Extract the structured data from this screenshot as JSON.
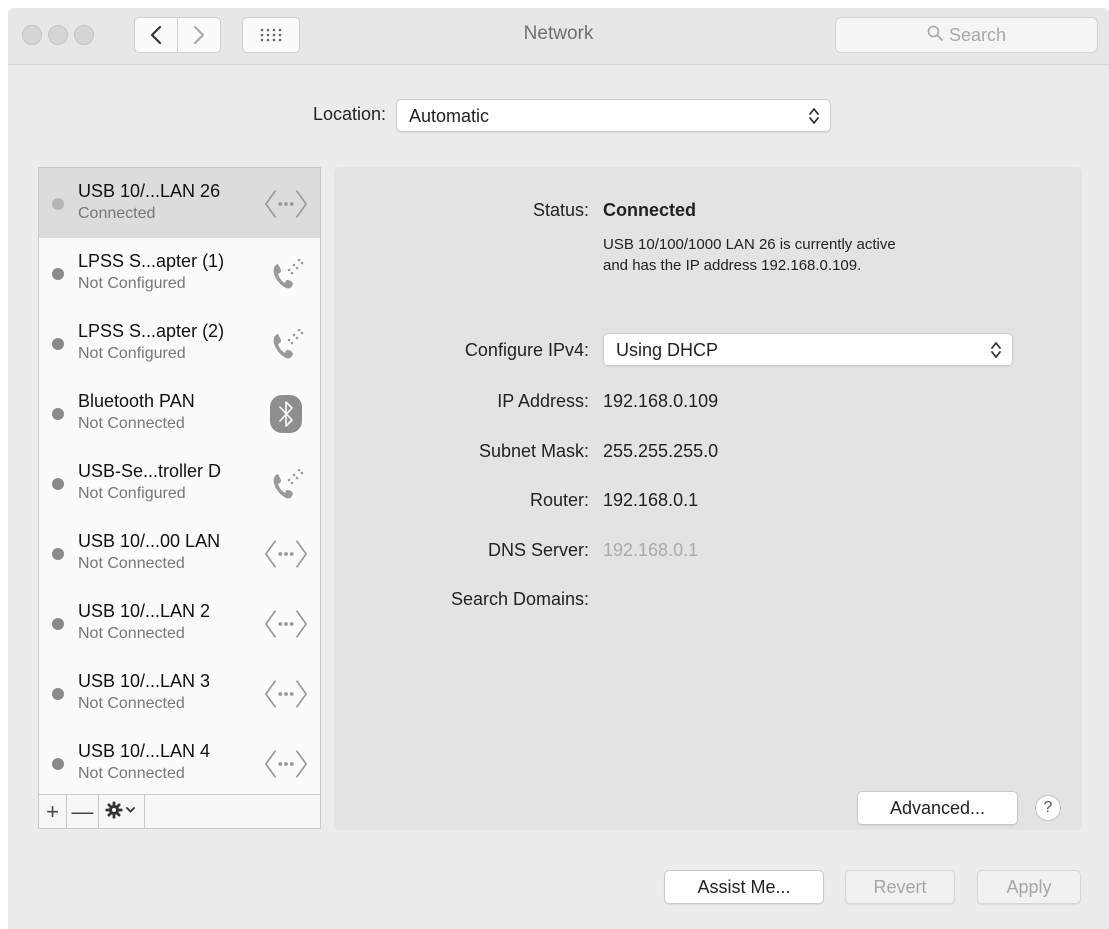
{
  "window": {
    "title": "Network"
  },
  "toolbar": {
    "back_icon": "chevron-left-icon",
    "forward_icon": "chevron-right-icon",
    "grid_icon": "show-all-grid-icon",
    "search_placeholder": "Search"
  },
  "location": {
    "label": "Location:",
    "value": "Automatic"
  },
  "services": [
    {
      "name": "USB 10/...LAN 26",
      "state": "Connected",
      "icon": "ethernet-icon",
      "status_color": "#b5b5b5",
      "selected": true
    },
    {
      "name": "LPSS S...apter (1)",
      "state": "Not Configured",
      "icon": "modem-phone-icon",
      "status_color": "#8a8a8a",
      "selected": false
    },
    {
      "name": "LPSS S...apter (2)",
      "state": "Not Configured",
      "icon": "modem-phone-icon",
      "status_color": "#8a8a8a",
      "selected": false
    },
    {
      "name": "Bluetooth PAN",
      "state": "Not Connected",
      "icon": "bluetooth-icon",
      "status_color": "#8a8a8a",
      "selected": false
    },
    {
      "name": "USB-Se...troller D",
      "state": "Not Configured",
      "icon": "modem-phone-icon",
      "status_color": "#8a8a8a",
      "selected": false
    },
    {
      "name": "USB 10/...00 LAN",
      "state": "Not Connected",
      "icon": "ethernet-icon",
      "status_color": "#8a8a8a",
      "selected": false
    },
    {
      "name": "USB 10/...LAN 2",
      "state": "Not Connected",
      "icon": "ethernet-icon",
      "status_color": "#8a8a8a",
      "selected": false
    },
    {
      "name": "USB 10/...LAN 3",
      "state": "Not Connected",
      "icon": "ethernet-icon",
      "status_color": "#8a8a8a",
      "selected": false
    },
    {
      "name": "USB 10/...LAN 4",
      "state": "Not Connected",
      "icon": "ethernet-icon",
      "status_color": "#8a8a8a",
      "selected": false
    }
  ],
  "sidebar_toolbar": {
    "add": "+",
    "remove": "—",
    "action_icon": "gear-icon"
  },
  "details": {
    "status_label": "Status:",
    "status_value": "Connected",
    "status_desc_1": "USB 10/100/1000 LAN 26 is currently active",
    "status_desc_2": "and has the IP address 192.168.0.109.",
    "configure_label": "Configure IPv4:",
    "configure_value": "Using DHCP",
    "ip_label": "IP Address:",
    "ip_value": "192.168.0.109",
    "subnet_label": "Subnet Mask:",
    "subnet_value": "255.255.255.0",
    "router_label": "Router:",
    "router_value": "192.168.0.1",
    "dns_label": "DNS Server:",
    "dns_value": "192.168.0.1",
    "search_domains_label": "Search Domains:",
    "advanced_label": "Advanced...",
    "help_label": "?"
  },
  "footer": {
    "assist_label": "Assist Me...",
    "revert_label": "Revert",
    "apply_label": "Apply"
  }
}
